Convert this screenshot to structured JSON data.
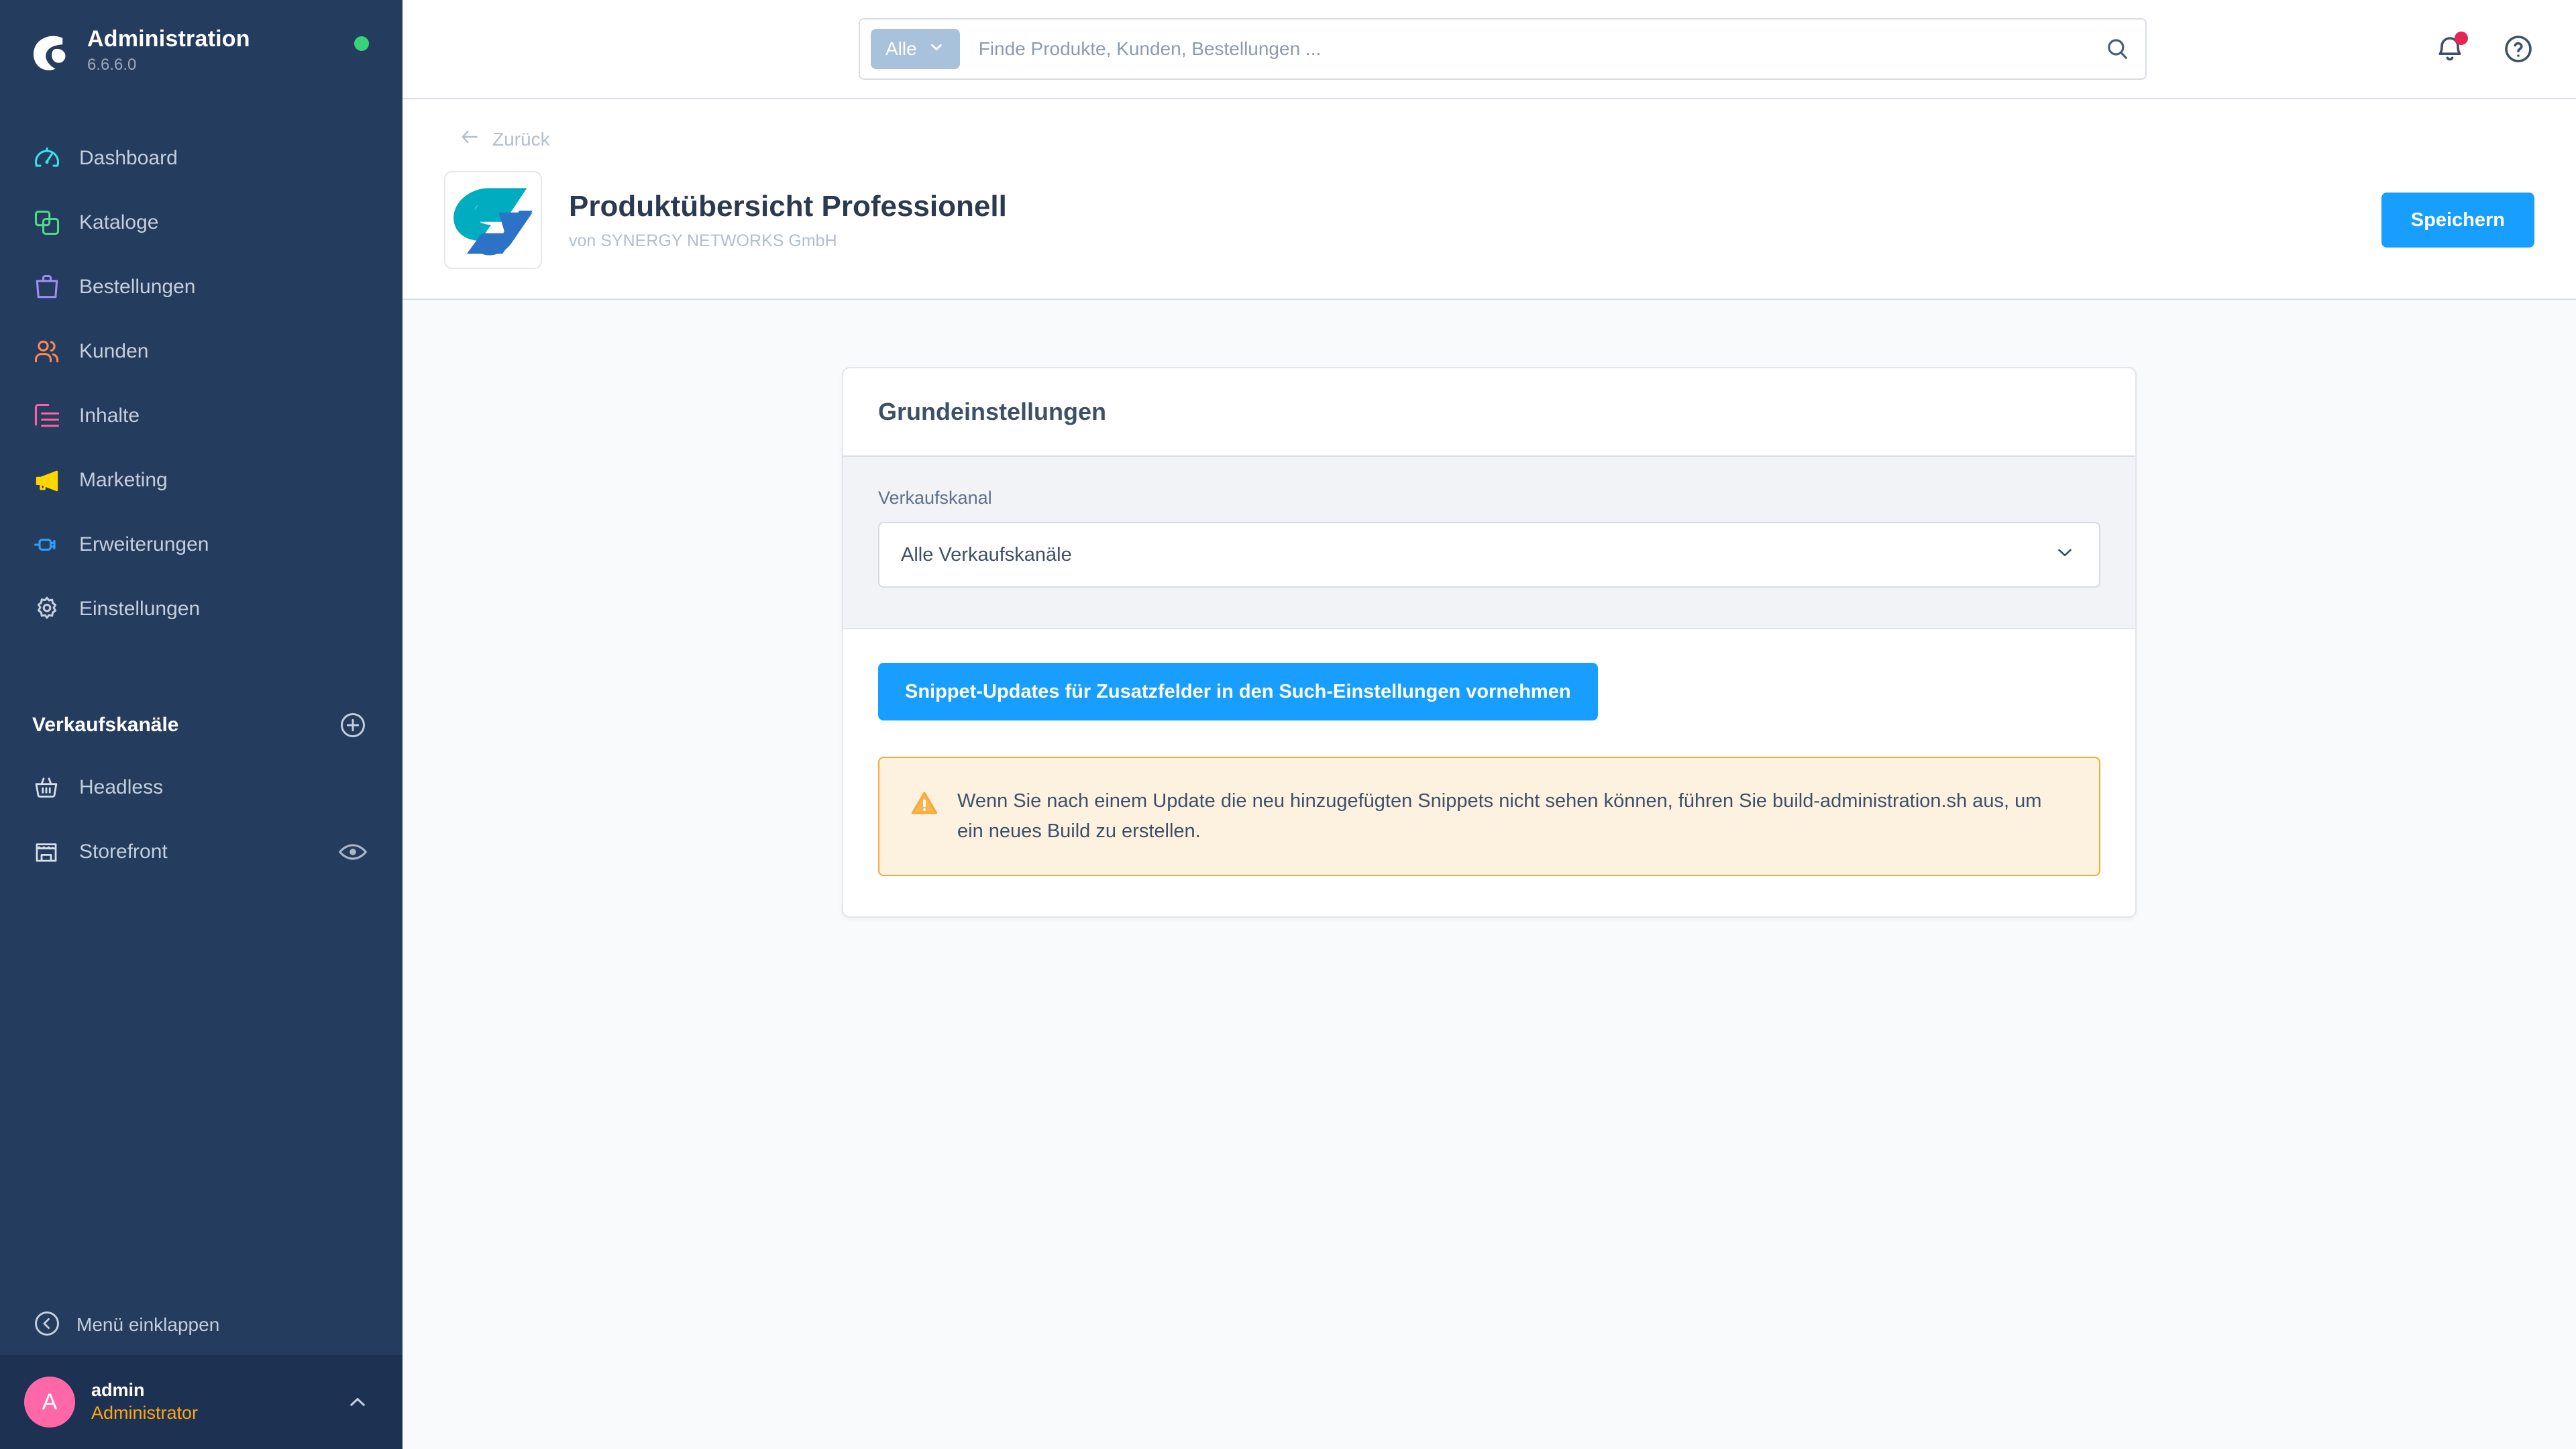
{
  "sidebar": {
    "brand": {
      "title": "Administration",
      "version": "6.6.6.0",
      "status_color": "#37D279"
    },
    "nav": [
      {
        "label": "Dashboard",
        "icon": "gauge-icon",
        "color": "#3CE0E8"
      },
      {
        "label": "Kataloge",
        "icon": "catalog-icon",
        "color": "#4ED98B"
      },
      {
        "label": "Bestellungen",
        "icon": "bag-icon",
        "color": "#A08CF5"
      },
      {
        "label": "Kunden",
        "icon": "users-icon",
        "color": "#FF8751"
      },
      {
        "label": "Inhalte",
        "icon": "content-icon",
        "color": "#FF5FA8"
      },
      {
        "label": "Marketing",
        "icon": "megaphone-icon",
        "color": "#FFD600"
      },
      {
        "label": "Erweiterungen",
        "icon": "plug-icon",
        "color": "#2CA0FF"
      },
      {
        "label": "Einstellungen",
        "icon": "gear-icon",
        "color": "#C4CEDC"
      }
    ],
    "section": {
      "title": "Verkaufskanäle",
      "add_icon": "plus-circle-icon"
    },
    "channels": [
      {
        "label": "Headless",
        "icon": "basket-icon",
        "trailing_icon": null
      },
      {
        "label": "Storefront",
        "icon": "shop-icon",
        "trailing_icon": "eye-icon"
      }
    ],
    "collapse": {
      "label": "Menü einklappen",
      "icon": "chevron-left-circle-icon"
    },
    "user": {
      "initial": "A",
      "name": "admin",
      "role": "Administrator",
      "caret_icon": "chevron-up-icon",
      "avatar_color": "#FF68A8",
      "role_color": "#FFA510"
    }
  },
  "topbar": {
    "search": {
      "scope_label": "Alle",
      "scope_caret_icon": "chevron-down-icon",
      "placeholder": "Finde Produkte, Kunden, Bestellungen ...",
      "value": "",
      "submit_icon": "search-icon"
    },
    "notifications_icon": "bell-icon",
    "notifications_badge": true,
    "help_icon": "question-circle-icon"
  },
  "pagehead": {
    "back_label": "Zurück",
    "back_icon": "arrow-left-icon",
    "plugin_logo_icon": "plugin-logo-icon",
    "title": "Produktübersicht Professionell",
    "author": "von SYNERGY NETWORKS GmbH",
    "save_label": "Speichern",
    "accent_color": "#189EFF"
  },
  "card": {
    "heading": "Grundeinstellungen",
    "field": {
      "label": "Verkaufskanal",
      "selected": "Alle Verkaufskanäle",
      "caret_icon": "chevron-down-icon"
    },
    "snippet_button": "Snippet-Updates für Zusatzfelder in den Such-Einstellungen vornehmen",
    "alert": {
      "icon": "warning-triangle-icon",
      "text": "Wenn Sie nach einem Update die neu hinzugefügten Snippets nicht sehen können, führen Sie build-administration.sh aus, um ein neues Build zu erstellen.",
      "border_color": "#F2AC3E",
      "bg_color": "#FDF1E0"
    }
  }
}
